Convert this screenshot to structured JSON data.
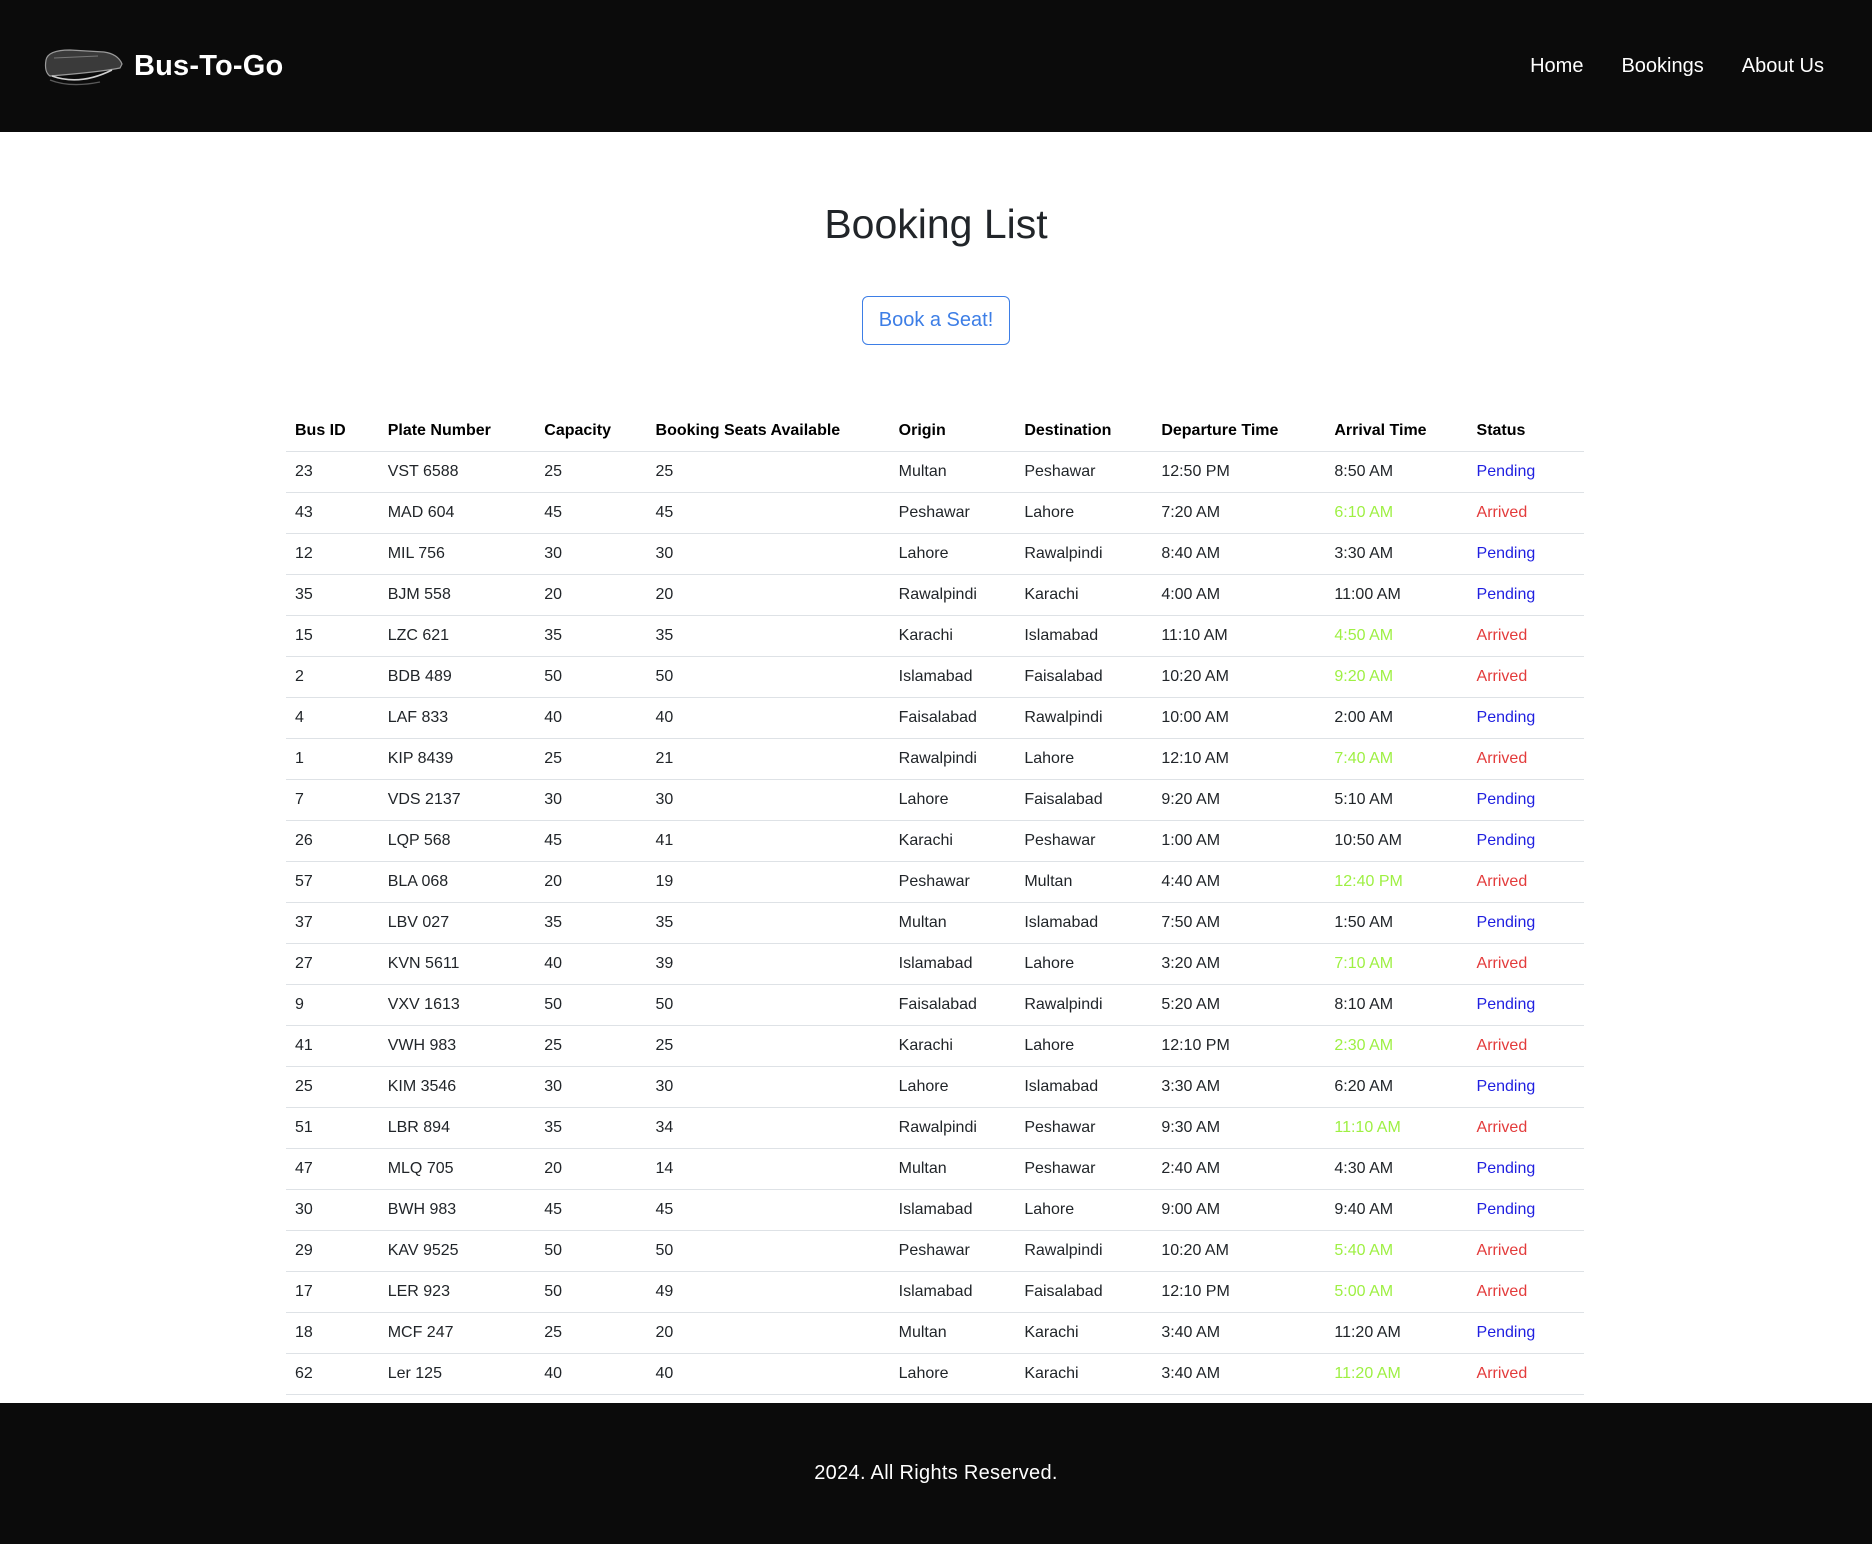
{
  "brand": {
    "name": "Bus-To-Go"
  },
  "nav": {
    "items": [
      {
        "label": "Home"
      },
      {
        "label": "Bookings"
      },
      {
        "label": "About Us"
      }
    ]
  },
  "main": {
    "title": "Booking List",
    "book_button": "Book a Seat!"
  },
  "colors": {
    "pending": "#1f1fe0",
    "arrived": "#e33b3b",
    "arrival_early": "#9ef043"
  },
  "table": {
    "headers": [
      "Bus ID",
      "Plate Number",
      "Capacity",
      "Booking Seats Available",
      "Origin",
      "Destination",
      "Departure Time",
      "Arrival Time",
      "Status"
    ],
    "rows": [
      [
        "23",
        "VST 6588",
        "25",
        "25",
        "Multan",
        "Peshawar",
        "12:50 PM",
        "8:50 AM",
        "Pending"
      ],
      [
        "43",
        "MAD 604",
        "45",
        "45",
        "Peshawar",
        "Lahore",
        "7:20 AM",
        "6:10 AM",
        "Arrived"
      ],
      [
        "12",
        "MIL 756",
        "30",
        "30",
        "Lahore",
        "Rawalpindi",
        "8:40 AM",
        "3:30 AM",
        "Pending"
      ],
      [
        "35",
        "BJM 558",
        "20",
        "20",
        "Rawalpindi",
        "Karachi",
        "4:00 AM",
        "11:00 AM",
        "Pending"
      ],
      [
        "15",
        "LZC 621",
        "35",
        "35",
        "Karachi",
        "Islamabad",
        "11:10 AM",
        "4:50 AM",
        "Arrived"
      ],
      [
        "2",
        "BDB 489",
        "50",
        "50",
        "Islamabad",
        "Faisalabad",
        "10:20 AM",
        "9:20 AM",
        "Arrived"
      ],
      [
        "4",
        "LAF 833",
        "40",
        "40",
        "Faisalabad",
        "Rawalpindi",
        "10:00 AM",
        "2:00 AM",
        "Pending"
      ],
      [
        "1",
        "KIP 8439",
        "25",
        "21",
        "Rawalpindi",
        "Lahore",
        "12:10 AM",
        "7:40 AM",
        "Arrived"
      ],
      [
        "7",
        "VDS 2137",
        "30",
        "30",
        "Lahore",
        "Faisalabad",
        "9:20 AM",
        "5:10 AM",
        "Pending"
      ],
      [
        "26",
        "LQP 568",
        "45",
        "41",
        "Karachi",
        "Peshawar",
        "1:00 AM",
        "10:50 AM",
        "Pending"
      ],
      [
        "57",
        "BLA 068",
        "20",
        "19",
        "Peshawar",
        "Multan",
        "4:40 AM",
        "12:40 PM",
        "Arrived"
      ],
      [
        "37",
        "LBV 027",
        "35",
        "35",
        "Multan",
        "Islamabad",
        "7:50 AM",
        "1:50 AM",
        "Pending"
      ],
      [
        "27",
        "KVN 5611",
        "40",
        "39",
        "Islamabad",
        "Lahore",
        "3:20 AM",
        "7:10 AM",
        "Arrived"
      ],
      [
        "9",
        "VXV 1613",
        "50",
        "50",
        "Faisalabad",
        "Rawalpindi",
        "5:20 AM",
        "8:10 AM",
        "Pending"
      ],
      [
        "41",
        "VWH 983",
        "25",
        "25",
        "Karachi",
        "Lahore",
        "12:10 PM",
        "2:30 AM",
        "Arrived"
      ],
      [
        "25",
        "KIM 3546",
        "30",
        "30",
        "Lahore",
        "Islamabad",
        "3:30 AM",
        "6:20 AM",
        "Pending"
      ],
      [
        "51",
        "LBR 894",
        "35",
        "34",
        "Rawalpindi",
        "Peshawar",
        "9:30 AM",
        "11:10 AM",
        "Arrived"
      ],
      [
        "47",
        "MLQ 705",
        "20",
        "14",
        "Multan",
        "Peshawar",
        "2:40 AM",
        "4:30 AM",
        "Pending"
      ],
      [
        "30",
        "BWH 983",
        "45",
        "45",
        "Islamabad",
        "Lahore",
        "9:00 AM",
        "9:40 AM",
        "Pending"
      ],
      [
        "29",
        "KAV 9525",
        "50",
        "50",
        "Peshawar",
        "Rawalpindi",
        "10:20 AM",
        "5:40 AM",
        "Arrived"
      ],
      [
        "17",
        "LER 923",
        "50",
        "49",
        "Islamabad",
        "Faisalabad",
        "12:10 PM",
        "5:00 AM",
        "Arrived"
      ],
      [
        "18",
        "MCF 247",
        "25",
        "20",
        "Multan",
        "Karachi",
        "3:40 AM",
        "11:20 AM",
        "Pending"
      ],
      [
        "62",
        "Ler 125",
        "40",
        "40",
        "Lahore",
        "Karachi",
        "3:40 AM",
        "11:20 AM",
        "Arrived"
      ]
    ]
  },
  "footer": {
    "text": "2024. All Rights Reserved."
  }
}
